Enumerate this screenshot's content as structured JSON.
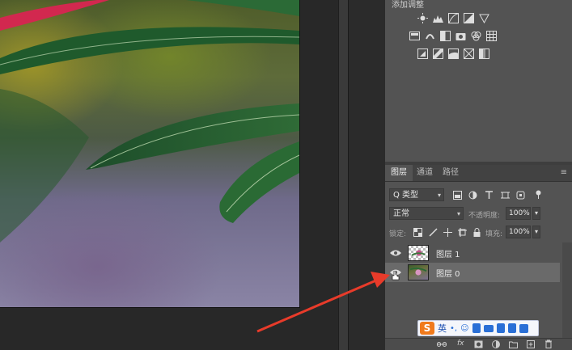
{
  "adjustments": {
    "title": "添加调整",
    "row1_icons": [
      "brightness-icon",
      "levels-icon",
      "curves-icon",
      "exposure-icon",
      "vibrance-triangle-icon"
    ],
    "row2_icons": [
      "hue-saturation-icon",
      "color-balance-icon",
      "black-white-icon",
      "photo-filter-icon",
      "channel-mixer-icon",
      "color-lookup-icon"
    ],
    "row3_icons": [
      "invert-icon",
      "posterize-icon",
      "threshold-icon",
      "selective-color-icon",
      "gradient-map-icon"
    ]
  },
  "layers_panel": {
    "tabs": [
      "图层",
      "通道",
      "路径"
    ],
    "filter_label": "Q 类型",
    "blend_mode": "正常",
    "opacity_label": "不透明度:",
    "opacity_value": "100%",
    "lock_label": "锁定:",
    "fill_label": "填充:",
    "fill_value": "100%",
    "layers": [
      {
        "name": "图层 1",
        "selected": false
      },
      {
        "name": "图层 0",
        "selected": true
      }
    ],
    "bottom_icons": [
      "link-icon",
      "fx-icon",
      "mask-icon",
      "adjustment-layer-icon",
      "group-folder-icon",
      "new-layer-icon",
      "trash-icon"
    ],
    "fx_label": "fx"
  },
  "ime": {
    "mode_label": "英",
    "punct": "•,"
  },
  "colors": {
    "panel_bg": "#535353",
    "selected_row": "#6a6a6a",
    "arrow": "#e83b2a"
  }
}
